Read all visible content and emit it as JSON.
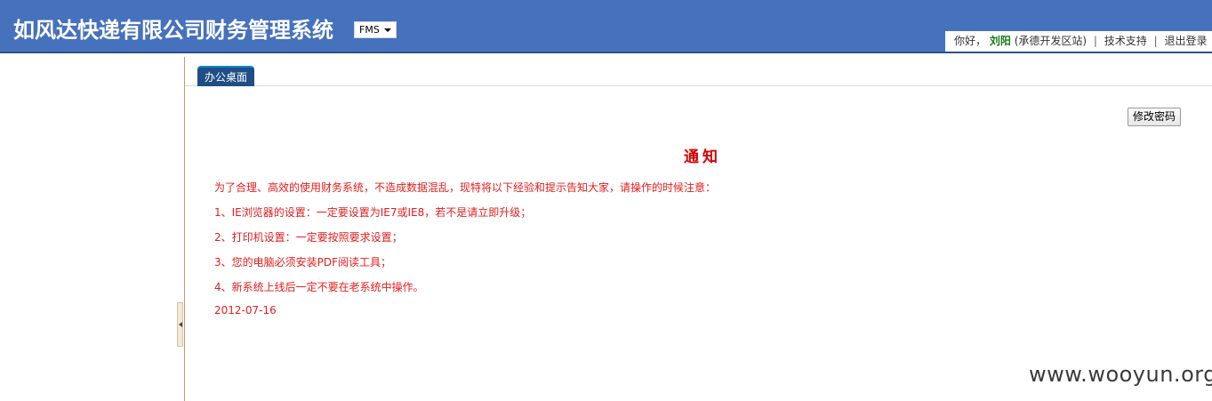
{
  "header": {
    "title": "如风达快递有限公司财务管理系统",
    "system_select": "FMS"
  },
  "userbar": {
    "greeting": "你好，",
    "user_name": "刘阳",
    "site": "(承德开发区站)",
    "sep1": "|",
    "tech_support": "技术支持",
    "sep2": "|",
    "logout": "退出登录"
  },
  "tabs": [
    {
      "label": "办公桌面"
    }
  ],
  "toolbar": {
    "change_password": "修改密码"
  },
  "notice": {
    "title": "通知",
    "intro": "为了合理、高效的使用财务系统，不造成数据混乱，现特将以下经验和提示告知大家，请操作的时候注意：",
    "items": [
      "1、IE浏览器的设置：一定要设置为IE7或IE8，若不是请立即升级；",
      "2、打印机设置：一定要按照要求设置；",
      "3、您的电脑必须安装PDF阅读工具；",
      "4、新系统上线后一定不要在老系统中操作。"
    ],
    "date": "2012-07-16"
  },
  "watermark": "www.wooyun.org",
  "colors": {
    "header_bg": "#4671bc",
    "notice_red": "#e31d1d",
    "tab_bg": "#1f4e86"
  }
}
